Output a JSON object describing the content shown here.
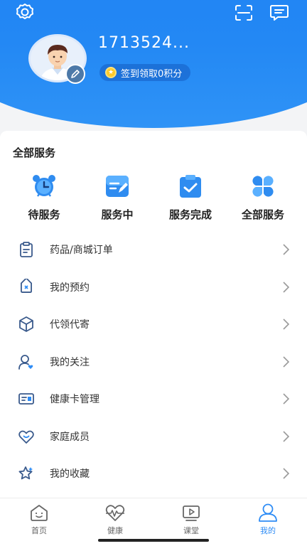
{
  "profile": {
    "username": "1713524...",
    "checkin_text": "签到领取0积分"
  },
  "services": {
    "title": "全部服务",
    "items": [
      {
        "label": "待服务",
        "icon": "alarm-clock-icon"
      },
      {
        "label": "服务中",
        "icon": "document-edit-icon"
      },
      {
        "label": "服务完成",
        "icon": "clipboard-check-icon"
      },
      {
        "label": "全部服务",
        "icon": "grid-petals-icon"
      }
    ]
  },
  "menu": [
    {
      "label": "药品/商城订单",
      "icon": "clipboard-icon"
    },
    {
      "label": "我的预约",
      "icon": "tag-icon"
    },
    {
      "label": "代领代寄",
      "icon": "package-box-icon"
    },
    {
      "label": "我的关注",
      "icon": "user-follow-icon"
    },
    {
      "label": "健康卡管理",
      "icon": "id-card-icon"
    },
    {
      "label": "家庭成员",
      "icon": "heart-smile-icon"
    },
    {
      "label": "我的收藏",
      "icon": "star-icon"
    }
  ],
  "tabbar": [
    {
      "label": "首页",
      "icon": "home-smile-icon",
      "active": false
    },
    {
      "label": "健康",
      "icon": "heart-pulse-icon",
      "active": false
    },
    {
      "label": "课堂",
      "icon": "video-play-icon",
      "active": false
    },
    {
      "label": "我的",
      "icon": "user-profile-icon",
      "active": true
    }
  ],
  "colors": {
    "brand": "#2388f4",
    "active_tab": "#2e8cf5",
    "menu_icon": "#3a5a8c"
  }
}
